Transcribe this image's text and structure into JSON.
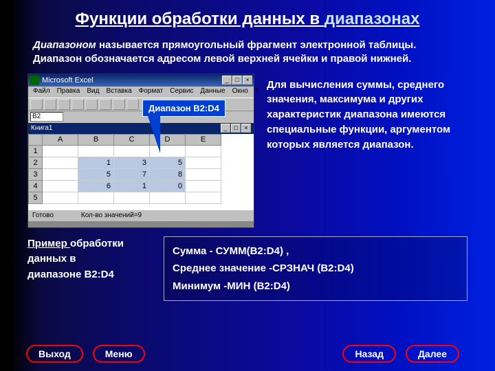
{
  "title": {
    "part1": "Функции обработки данных в ",
    "part2": "диапазонах"
  },
  "intro": {
    "term": "Диапазоном ",
    "text": "называется прямоугольный фрагмент электронной таблицы. Диапазон обозначается адресом левой верхней ячейки и правой нижней."
  },
  "excel": {
    "app": "Microsoft Excel",
    "menus": [
      "Файл",
      "Правка",
      "Вид",
      "Вставка",
      "Формат",
      "Сервис",
      "Данные",
      "Окно",
      "?"
    ],
    "cellref": "B2",
    "book": "Книга1",
    "cols": [
      "A",
      "B",
      "C",
      "D",
      "E"
    ],
    "rows": [
      [
        "1",
        "",
        "",
        "",
        "",
        ""
      ],
      [
        "2",
        "",
        "1",
        "3",
        "5",
        ""
      ],
      [
        "3",
        "",
        "5",
        "7",
        "8",
        ""
      ],
      [
        "4",
        "",
        "6",
        "1",
        "0",
        ""
      ],
      [
        "5",
        "",
        "",
        "",
        "",
        ""
      ]
    ],
    "status": "Готово",
    "status2": "Кол-во значений=9"
  },
  "callout": "Диапазон B2:D4",
  "sidetext": "Для вычисления суммы, среднего значения, максимума и других характеристик  диапазона имеются специальные функции, аргументом которых является  диапазон.",
  "example": {
    "u": "Пример ",
    "rest": "обработки данных в",
    "last": "диапазоне B2:D4"
  },
  "formulas": {
    "l1": "Сумма  -   СУММ(B2:D4) ,",
    "l2": "Среднее значение -СРЗНАЧ (B2:D4)",
    "l3": "Минимум -МИН (B2:D4)"
  },
  "nav": {
    "exit": "Выход",
    "menu": "Меню",
    "back": "Назад",
    "next": "Далее"
  }
}
